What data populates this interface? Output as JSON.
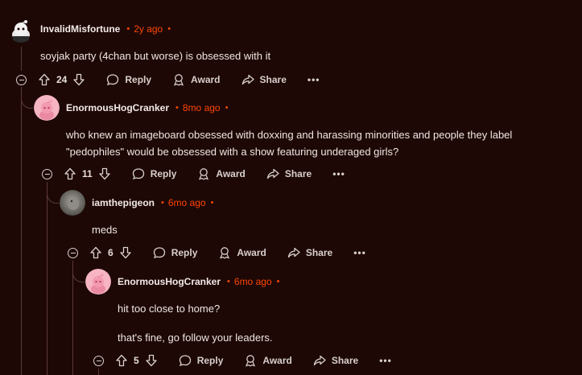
{
  "comments": [
    {
      "username": "InvalidMisfortune",
      "time": "2y ago",
      "body": [
        "soyjak party (4chan but worse) is obsessed with it"
      ],
      "score": "24",
      "avatar": "snoo-white-avatar"
    },
    {
      "username": "EnormousHogCranker",
      "time": "8mo ago",
      "body": [
        "who knew an imageboard obsessed with doxxing and harassing minorities and people they label",
        "\"pedophiles\" would be obsessed with a show featuring underaged girls?"
      ],
      "score": "11",
      "avatar": "snoo-pink-avatar"
    },
    {
      "username": "iamthepigeon",
      "time": "6mo ago",
      "body": [
        "meds"
      ],
      "score": "6",
      "avatar": "pigeon-photo-avatar"
    },
    {
      "username": "EnormousHogCranker",
      "time": "6mo ago",
      "body": [
        "hit too close to home?",
        "that's fine, go follow your leaders."
      ],
      "score": "5",
      "avatar": "snoo-pink-avatar"
    }
  ],
  "labels": {
    "reply": "Reply",
    "award": "Award",
    "share": "Share",
    "more": "•••"
  },
  "colors": {
    "background": "#1d0806",
    "accent": "#ff4500",
    "thread_line": "#5b3a36"
  }
}
